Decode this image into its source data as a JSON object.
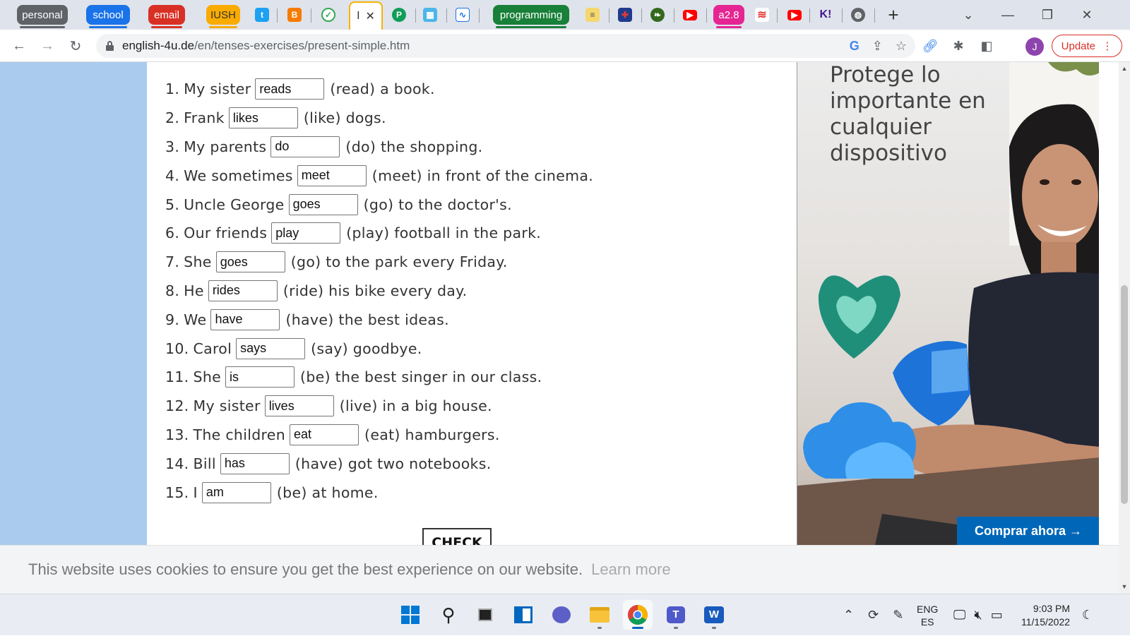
{
  "tabs": {
    "groups": [
      {
        "label": "personal",
        "color": "#5f6368"
      },
      {
        "label": "school",
        "color": "#1a73e8"
      },
      {
        "label": "email",
        "color": "#d93025"
      },
      {
        "label": "IUSH",
        "color": "#f9ab00"
      },
      {
        "label": "programming",
        "color": "#188038"
      },
      {
        "label": "a2.8",
        "color": "#e52592"
      }
    ],
    "active_tab_letter": "I",
    "close_glyph": "✕",
    "new_tab_glyph": "+",
    "k_label": "K!"
  },
  "toolbar": {
    "url_host": "english-4u.de",
    "url_path": "/en/tenses-exercises/present-simple.htm",
    "profile_initial": "J",
    "update_label": "Update"
  },
  "exercise": {
    "items": [
      {
        "num": "1.",
        "before": "My sister",
        "answer": "reads",
        "after": "(read) a book."
      },
      {
        "num": "2.",
        "before": "Frank",
        "answer": "likes",
        "after": "(like) dogs."
      },
      {
        "num": "3.",
        "before": "My parents",
        "answer": "do",
        "after": "(do) the shopping."
      },
      {
        "num": "4.",
        "before": "We sometimes",
        "answer": "meet",
        "after": "(meet) in front of the cinema."
      },
      {
        "num": "5.",
        "before": "Uncle George",
        "answer": "goes",
        "after": "(go) to the doctor's."
      },
      {
        "num": "6.",
        "before": "Our friends",
        "answer": "play",
        "after": "(play) football in the park."
      },
      {
        "num": "7.",
        "before": "She",
        "answer": "goes",
        "after": "(go) to the park every Friday."
      },
      {
        "num": "8.",
        "before": "He",
        "answer": "rides",
        "after": "(ride) his bike every day."
      },
      {
        "num": "9.",
        "before": "We",
        "answer": "have",
        "after": "(have) the best ideas."
      },
      {
        "num": "10.",
        "before": "Carol",
        "answer": "says",
        "after": "(say) goodbye."
      },
      {
        "num": "11.",
        "before": "She",
        "answer": "is",
        "after": "(be) the best singer in our class."
      },
      {
        "num": "12.",
        "before": "My sister",
        "answer": "lives",
        "after": "(live) in a big house."
      },
      {
        "num": "13.",
        "before": "The children",
        "answer": "eat",
        "after": "(eat) hamburgers."
      },
      {
        "num": "14.",
        "before": "Bill",
        "answer": "has",
        "after": "(have) got two notebooks."
      },
      {
        "num": "15.",
        "before": "I",
        "answer": "am",
        "after": "(be) at home."
      }
    ],
    "check_label": "CHECK"
  },
  "ad": {
    "headline": "Protege lo importante en cualquier dispositivo",
    "cta": "Comprar ahora →"
  },
  "cookie": {
    "message": "This website uses cookies to ensure you get the best experience on our website.",
    "learn_more": "Learn more"
  },
  "taskbar": {
    "lang_top": "ENG",
    "lang_bottom": "ES",
    "time": "9:03 PM",
    "date": "11/15/2022"
  }
}
